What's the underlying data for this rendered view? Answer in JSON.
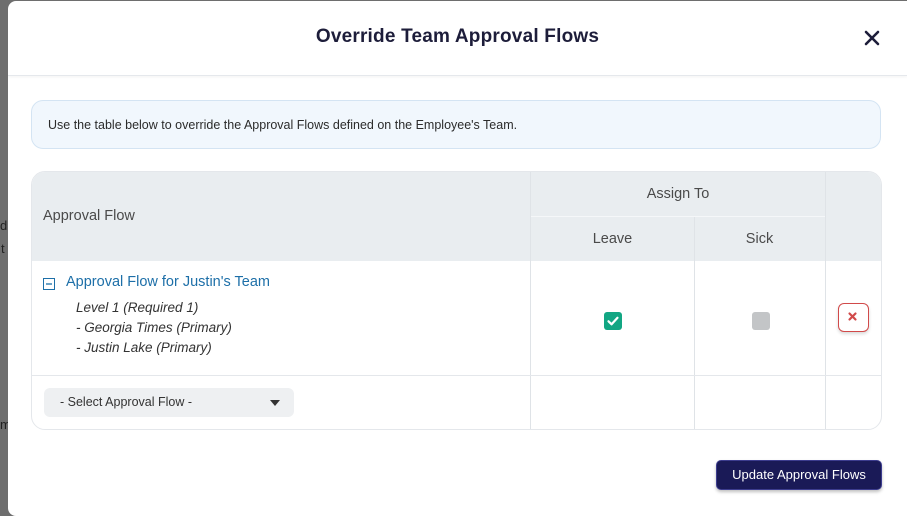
{
  "background": {
    "fragments": [
      "d",
      "t",
      "m"
    ]
  },
  "modal": {
    "title": "Override Team Approval Flows",
    "info_text": "Use the table below to override the Approval Flows defined on the Employee's Team.",
    "table": {
      "headers": {
        "approval_flow": "Approval Flow",
        "assign_to": "Assign To",
        "leave": "Leave",
        "sick": "Sick"
      },
      "rows": [
        {
          "flow_name": "Approval Flow for Justin's Team",
          "details": [
            "Level 1 (Required 1)",
            "- Georgia Times (Primary)",
            "- Justin Lake (Primary)"
          ],
          "leave_checked": true,
          "sick_checked": false
        }
      ],
      "select_placeholder": "- Select Approval Flow -"
    },
    "update_button": "Update Approval Flows"
  },
  "colors": {
    "primary": "#1a1a57",
    "link": "#1d6fa8",
    "checked": "#12a683",
    "danger": "#d14a4a"
  }
}
